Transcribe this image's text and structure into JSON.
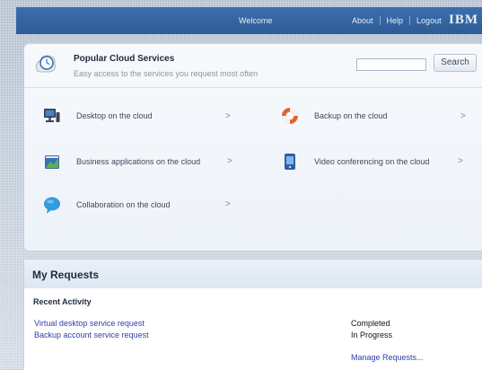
{
  "topbar": {
    "welcome": "Welcome",
    "links": [
      "About",
      "Help",
      "Logout"
    ],
    "logo": "IBM"
  },
  "popular": {
    "title": "Popular Cloud Services",
    "subtitle": "Easy access to the services you request most often",
    "search_button": "Search",
    "search_placeholder": "",
    "services": [
      {
        "label": "Desktop on the cloud",
        "icon": "desktop-computer-icon"
      },
      {
        "label": "Backup on the cloud",
        "icon": "lifebuoy-icon"
      },
      {
        "label": "Business applications on the cloud",
        "icon": "business-chart-icon"
      },
      {
        "label": "Video conferencing on the cloud",
        "icon": "video-device-icon"
      },
      {
        "label": "Collaboration on the cloud",
        "icon": "speech-bubble-icon"
      }
    ],
    "chevron": ">"
  },
  "requests": {
    "title": "My Requests",
    "recent_label": "Recent Activity",
    "rows": [
      {
        "name": "Virtual desktop service request",
        "status": "Completed"
      },
      {
        "name": "Backup account service request",
        "status": "In Progress"
      }
    ],
    "manage_link": "Manage Requests..."
  },
  "colors": {
    "topbar": "#2d5b95",
    "link": "#2b3fb0",
    "panel": "#eef3f9"
  }
}
